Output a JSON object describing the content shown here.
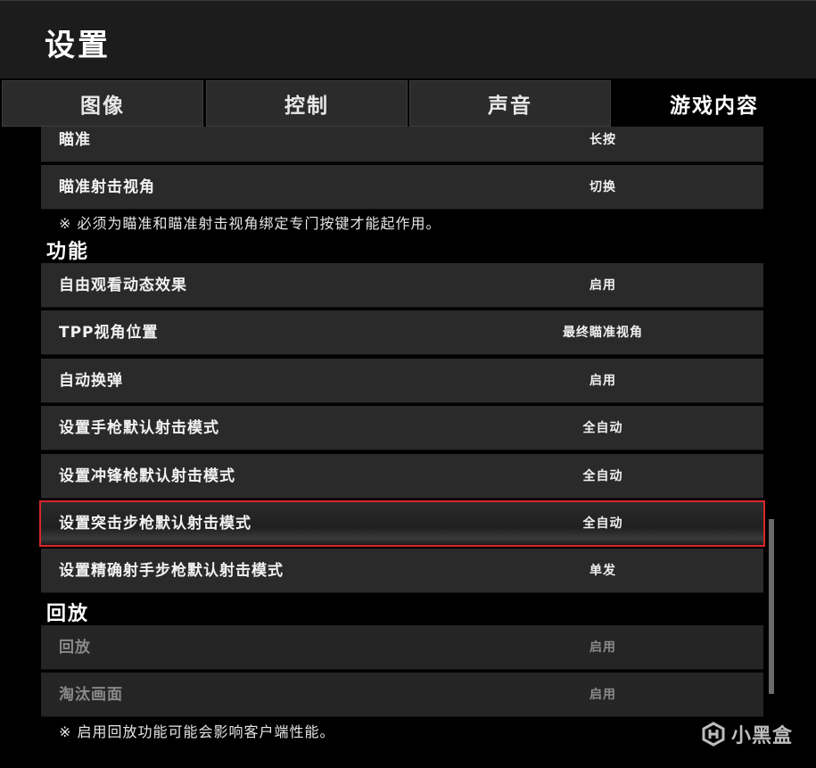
{
  "header": {
    "title": "设置"
  },
  "tabs": [
    {
      "label": "图像",
      "active": false
    },
    {
      "label": "控制",
      "active": false
    },
    {
      "label": "声音",
      "active": false
    },
    {
      "label": "游戏内容",
      "active": true
    }
  ],
  "aim_rows": [
    {
      "label": "瞄准",
      "value": "长按"
    },
    {
      "label": "瞄准射击视角",
      "value": "切换"
    }
  ],
  "aim_note": "※ 必须为瞄准和瞄准射击视角绑定专门按键才能起作用。",
  "functions": {
    "title": "功能",
    "rows": [
      {
        "label": "自由观看动态效果",
        "value": "启用"
      },
      {
        "label": "TPP视角位置",
        "value": "最终瞄准视角"
      },
      {
        "label": "自动换弹",
        "value": "启用"
      },
      {
        "label": "设置手枪默认射击模式",
        "value": "全自动"
      },
      {
        "label": "设置冲锋枪默认射击模式",
        "value": "全自动"
      },
      {
        "label": "设置突击步枪默认射击模式",
        "value": "全自动"
      },
      {
        "label": "设置精确射手步枪默认射击模式",
        "value": "单发"
      }
    ]
  },
  "replay": {
    "title": "回放",
    "rows": [
      {
        "label": "回放",
        "value": "启用"
      },
      {
        "label": "淘汰画面",
        "value": "启用"
      }
    ],
    "note": "※ 启用回放功能可能会影响客户端性能。"
  },
  "watermark": {
    "text": "小黑盒"
  },
  "colors": {
    "highlight": "#d8262b",
    "row_bg": "#2a2a2a",
    "header_bg": "#1c1c1c"
  }
}
